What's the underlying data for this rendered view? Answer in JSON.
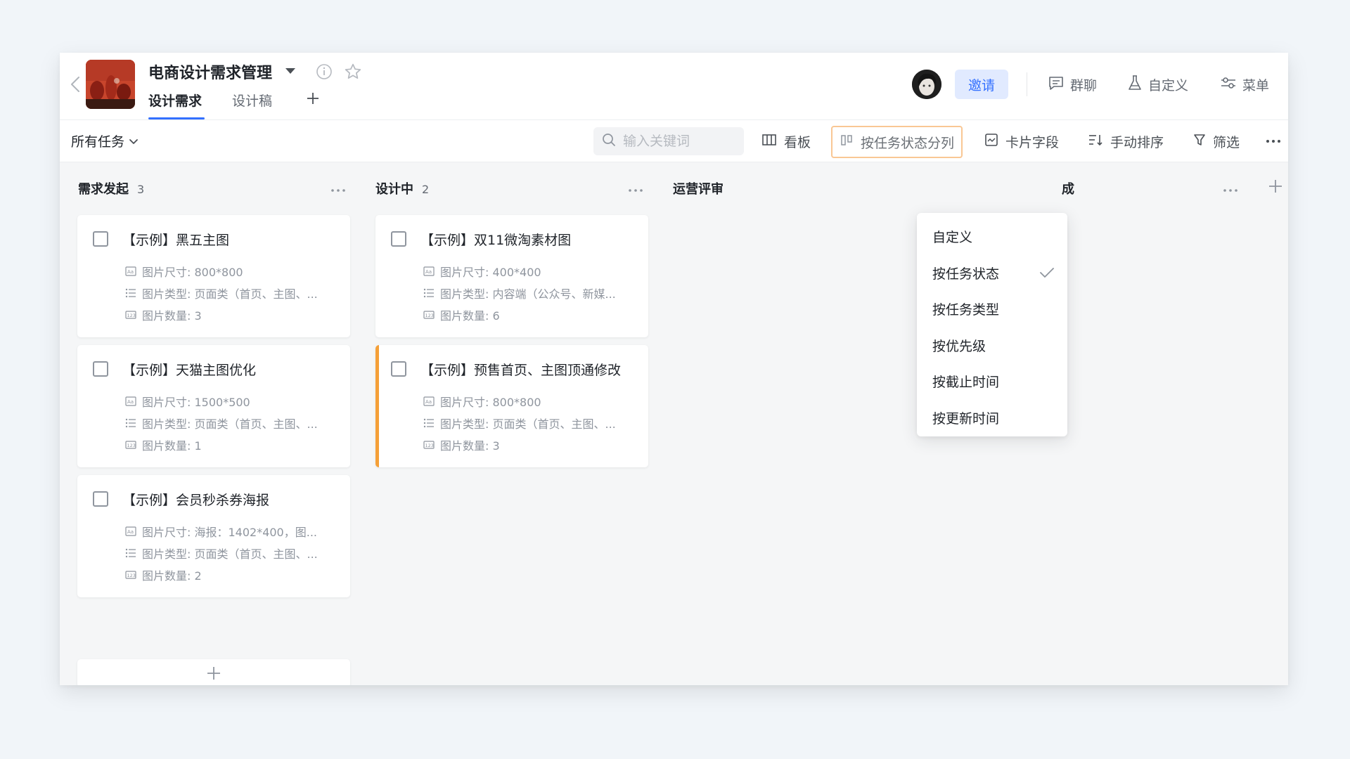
{
  "header": {
    "project_title": "电商设计需求管理",
    "tabs": [
      {
        "label": "设计需求",
        "active": true
      },
      {
        "label": "设计稿",
        "active": false
      }
    ],
    "invite_label": "邀请",
    "actions": [
      {
        "label": "群聊",
        "icon": "chat-icon"
      },
      {
        "label": "自定义",
        "icon": "flask-icon"
      },
      {
        "label": "菜单",
        "icon": "menu-sliders-icon"
      }
    ]
  },
  "toolbar": {
    "filter_label": "所有任务",
    "search": {
      "placeholder": "输入关键词",
      "value": ""
    },
    "view_label": "看板",
    "group_label": "按任务状态分列",
    "card_fields_label": "卡片字段",
    "sort_label": "手动排序",
    "filter_btn_label": "筛选"
  },
  "columns": [
    {
      "title": "需求发起",
      "count": "3",
      "cards": [
        {
          "title": "【示例】黑五主图",
          "size": "图片尺寸: 800*800",
          "type": "图片类型: 页面类（首页、主图、...",
          "qty": "图片数量: 3"
        },
        {
          "title": "【示例】天猫主图优化",
          "size": "图片尺寸: 1500*500",
          "type": "图片类型: 页面类（首页、主图、...",
          "qty": "图片数量: 1"
        },
        {
          "title": "【示例】会员秒杀券海报",
          "size": "图片尺寸: 海报：1402*400，图...",
          "type": "图片类型: 页面类（首页、主图、...",
          "qty": "图片数量: 2"
        }
      ]
    },
    {
      "title": "设计中",
      "count": "2",
      "cards": [
        {
          "title": "【示例】双11微淘素材图",
          "size": "图片尺寸: 400*400",
          "type": "图片类型: 内容端（公众号、新媒...",
          "qty": "图片数量: 6"
        },
        {
          "title": "【示例】预售首页、主图顶通修改",
          "size": "图片尺寸: 800*800",
          "type": "图片类型: 页面类（首页、主图、...",
          "qty": "图片数量: 3"
        }
      ]
    },
    {
      "title": "运营评审",
      "count": "",
      "cards": []
    },
    {
      "title": "成",
      "count": "",
      "cards": []
    }
  ],
  "dropdown": {
    "items": [
      {
        "label": "自定义",
        "checked": false
      },
      {
        "label": "按任务状态",
        "checked": true
      },
      {
        "label": "按任务类型",
        "checked": false
      },
      {
        "label": "按优先级",
        "checked": false
      },
      {
        "label": "按截止时间",
        "checked": false
      },
      {
        "label": "按更新时间",
        "checked": false
      }
    ]
  },
  "colors": {
    "accent": "#3370ff",
    "invite_bg": "#e1eaff",
    "flag": "#f5a038",
    "active_outline": "#f9c794"
  }
}
